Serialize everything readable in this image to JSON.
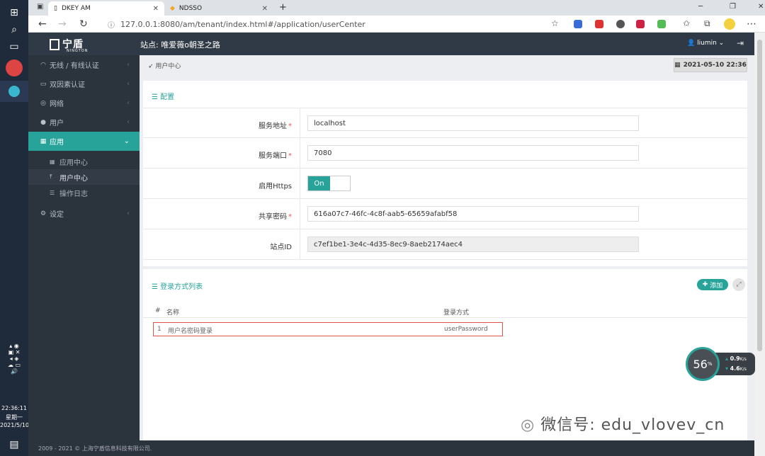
{
  "taskbar": {
    "time": "22:36:11",
    "weekday": "星期一",
    "date": "2021/5/10"
  },
  "browser": {
    "tabs": [
      {
        "title": "DKEY AM"
      },
      {
        "title": "NDSSO"
      }
    ],
    "url": "127.0.0.1:8080/am/tenant/index.html#/application/userCenter",
    "new_tab": "+",
    "window_controls": [
      "─",
      "❐",
      "✕"
    ]
  },
  "app": {
    "logo": "宁盾",
    "logo_sub": "NINGTON",
    "site_title": "站点: 唯爱薇o朝圣之路",
    "user": "liumin"
  },
  "sidebar": {
    "items": [
      {
        "label": "无线 / 有线认证",
        "icon": "wifi-icon"
      },
      {
        "label": "双因素认证",
        "icon": "briefcase-icon"
      },
      {
        "label": "网络",
        "icon": "globe-icon"
      },
      {
        "label": "用户",
        "icon": "user-icon"
      },
      {
        "label": "应用",
        "icon": "grid-icon"
      },
      {
        "label": "设定",
        "icon": "gear-icon"
      }
    ],
    "subitems": [
      {
        "label": "应用中心",
        "icon": "grid-icon"
      },
      {
        "label": "用户中心",
        "icon": "upload-icon"
      },
      {
        "label": "操作日志",
        "icon": "list-icon"
      }
    ]
  },
  "main": {
    "breadcrumb": "用户中心",
    "date": "2021-05-10 22:36",
    "config": {
      "title": "配置",
      "fields": [
        {
          "label": "服务地址",
          "required": "*",
          "value": "localhost"
        },
        {
          "label": "服务端口",
          "required": "*",
          "value": "7080"
        },
        {
          "label": "启用Https",
          "toggle": "On"
        },
        {
          "label": "共享密码",
          "required": "*",
          "value": "616a07c7-46fc-4c8f-aab5-65659afabf58"
        },
        {
          "label": "站点ID",
          "value": "c7ef1be1-3e4c-4d35-8ec9-8aeb2174aec4"
        }
      ]
    },
    "login_list": {
      "title": "登录方式列表",
      "add_label": "添加",
      "columns": [
        "#",
        "名称",
        "登录方式"
      ],
      "rows": [
        {
          "index": "1",
          "name": "用户名密码登录",
          "method": "userPassword"
        }
      ]
    }
  },
  "footer": "2009 - 2021 © 上海宁盾信息科技有限公司.",
  "speed_widget": {
    "percent": "56",
    "unit": "%",
    "up": "0.9",
    "down": "4.6",
    "rate_unit": "K/s"
  },
  "watermark": "微信号: edu_vlovev_cn"
}
